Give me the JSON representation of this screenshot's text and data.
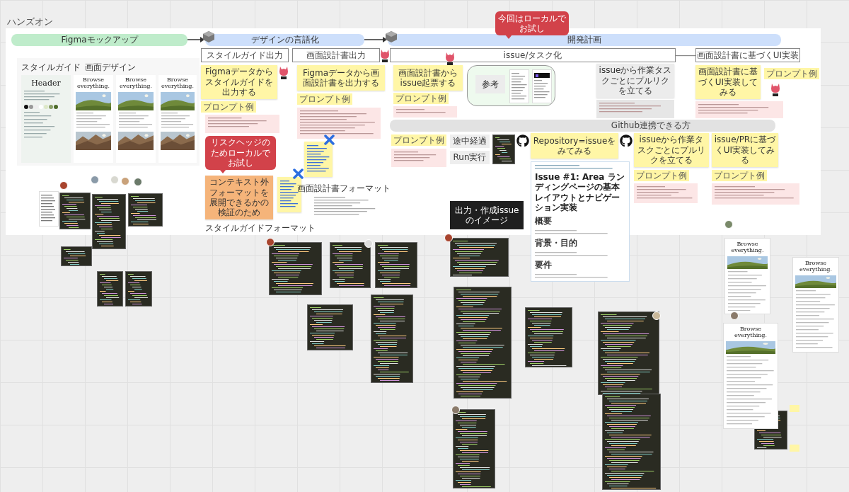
{
  "board": {
    "title": "ハンズオン"
  },
  "phases": [
    {
      "label": "Figmaモックアップ",
      "color": "#bfeccb"
    },
    {
      "label": "デザインの言語化",
      "color": "#cddffb"
    },
    {
      "label": "開発計画",
      "color": "#cddffb"
    }
  ],
  "mockup": {
    "styleguide_title": "スタイルガイド",
    "design_title": "画面デザイン",
    "header_sample": "Header",
    "hero_texts": [
      "Browse everything.",
      "Browse everything.",
      "Browse everything."
    ]
  },
  "task_frames": [
    {
      "label": "スタイルガイド出力"
    },
    {
      "label": "画面設計書出力"
    },
    {
      "label": "issue/タスク化"
    },
    {
      "label": "画面設計書に基づくUI実装"
    }
  ],
  "stickies": [
    {
      "text": "Figmaデータからスタイルガイドを出力する",
      "color": "#fff6a6"
    },
    {
      "text": "Figmaデータから画面設計書を出力する",
      "color": "#fff6a6"
    },
    {
      "text": "画面設計書からissue起票する",
      "color": "#fff6a6"
    },
    {
      "text": "issueから作業タスクごとにプルリクを立てる",
      "color": "#ececec"
    },
    {
      "text": "画面設計書に基づくUI実装してみる",
      "color": "#fff6a6"
    },
    {
      "text": "Repository=issueをみてみる",
      "color": "#fff6a6"
    },
    {
      "text": "issueから作業タスクごとにプルリクを立てる",
      "color": "#fff6a6"
    },
    {
      "text": "issue/PRに基づくUI実装してみる",
      "color": "#fff6a6"
    },
    {
      "text": "コンテキスト外フォーマットを展開できるかの検証のため",
      "color": "#f5b47a"
    }
  ],
  "prompt_tags": [
    "プロンプト例",
    "プロンプト例",
    "プロンプト例",
    "プロンプト例",
    "プロンプト例",
    "プロンプト例",
    "プロンプト例"
  ],
  "notes": [
    {
      "color": "#fce6e6"
    },
    {
      "color": "#fce6e6"
    },
    {
      "color": "#fce6e6"
    },
    {
      "color": "#e6e6e6"
    },
    {
      "color": "#fce6e6"
    },
    {
      "color": "#fce6e6"
    },
    {
      "color": "#fce6e6"
    },
    {
      "color": "#fce6e6"
    }
  ],
  "bubbles": [
    {
      "text": "リスクヘッジのためローカルでお試し"
    },
    {
      "text": "今回はローカルでお試し"
    }
  ],
  "format_headings": [
    "スタイルガイドフォーマット",
    "画面設計書フォーマット"
  ],
  "reference": {
    "label": "参考"
  },
  "github_section": {
    "label": "Github連携できる方"
  },
  "progress_labels": [
    "途中経過",
    "Run実行"
  ],
  "issue_image_label": "出力・作成issueのイメージ",
  "issue_doc": {
    "title": "Issue #1: Area ランディングページの基本レイアウトとナビゲーション実装",
    "sections": [
      "概要",
      "背景・目的",
      "要件"
    ]
  },
  "right_designs": [
    {
      "hero": "Browse everything."
    },
    {
      "hero": "Browse everything."
    },
    {
      "hero": "Browse everything."
    }
  ]
}
